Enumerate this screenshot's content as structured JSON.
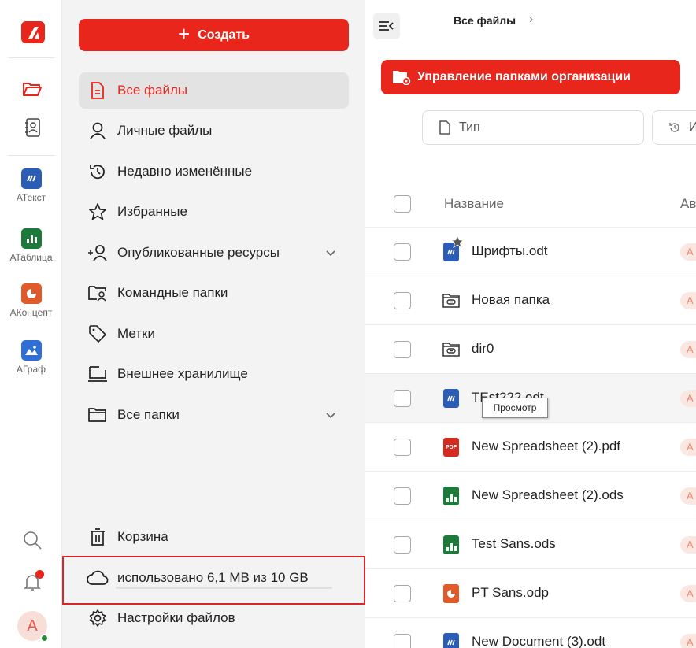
{
  "rail": {
    "apps": [
      {
        "label": "АТекст",
        "icon": "atext-icon",
        "color": "#2b5db6"
      },
      {
        "label": "АТаблица",
        "icon": "atable-icon",
        "color": "#1d7a3a"
      },
      {
        "label": "АКонцепт",
        "icon": "aconcept-icon",
        "color": "#e05a2a"
      },
      {
        "label": "АГраф",
        "icon": "agraph-icon",
        "color": "#2d6fd6"
      }
    ],
    "avatar_letter": "А"
  },
  "sidebar": {
    "create_label": "Создать",
    "items": [
      {
        "label": "Все файлы",
        "icon": "file-icon"
      },
      {
        "label": "Личные файлы",
        "icon": "user-icon"
      },
      {
        "label": "Недавно изменённые",
        "icon": "history-icon"
      },
      {
        "label": "Избранные",
        "icon": "star-icon"
      },
      {
        "label": "Опубликованные ресурсы",
        "icon": "share-user-icon"
      },
      {
        "label": "Командные папки",
        "icon": "team-folder-icon"
      },
      {
        "label": "Метки",
        "icon": "tag-icon"
      },
      {
        "label": "Внешнее хранилище",
        "icon": "monitor-icon"
      },
      {
        "label": "Все папки",
        "icon": "folder-icon"
      }
    ],
    "trash_label": "Корзина",
    "storage_label": "использовано 6,1 MB из 10 GB",
    "settings_label": "Настройки файлов"
  },
  "main": {
    "breadcrumb": "Все файлы",
    "org_button_label": "Управление папками организации",
    "filter_type": "Тип",
    "filter_second_partial": "И",
    "columns": {
      "name": "Название",
      "author": "Ав"
    },
    "rows": [
      {
        "name": "Шрифты.odt",
        "type": "doc",
        "starred": true,
        "author": "А"
      },
      {
        "name": "Новая папка",
        "type": "folder-link",
        "author": "А"
      },
      {
        "name": "dir0",
        "type": "folder-link",
        "author": "А"
      },
      {
        "name": "TEst222.odt",
        "type": "doc",
        "author": "А"
      },
      {
        "name": "New Spreadsheet (2).pdf",
        "type": "pdf",
        "author": "А"
      },
      {
        "name": "New Spreadsheet (2).ods",
        "type": "sheet",
        "author": "А"
      },
      {
        "name": "Test Sans.ods",
        "type": "sheet",
        "author": "А"
      },
      {
        "name": "PT Sans.odp",
        "type": "pres",
        "author": "А"
      },
      {
        "name": "New Document (3).odt",
        "type": "doc",
        "author": "А"
      }
    ],
    "tooltip": "Просмотр",
    "pdf_badge": "PDF"
  },
  "colors": {
    "accent": "#e8261c",
    "highlight_border": "#d9262b"
  }
}
